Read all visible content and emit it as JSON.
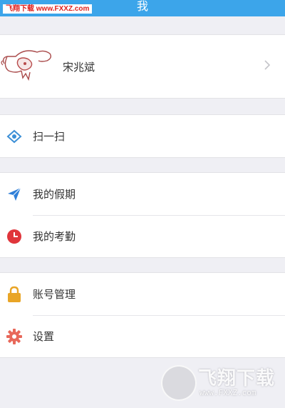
{
  "header": {
    "title": "我"
  },
  "watermark_top": {
    "text": "飞翔下载 www.FXXZ.com"
  },
  "profile": {
    "name": "宋兆斌"
  },
  "menu": {
    "scan": "扫一扫",
    "vacation": "我的假期",
    "attendance": "我的考勤",
    "account": "账号管理",
    "settings": "设置"
  },
  "watermark_bottom": {
    "brand": "飞翔下载",
    "url": "www.FXXZ.com"
  },
  "colors": {
    "header": "#3ca5ea",
    "scan_icon": "#3c8fd6",
    "vacation_icon": "#2f7fd8",
    "attendance_icon": "#e0353b",
    "account_icon": "#e9a526",
    "settings_icon": "#e8685a"
  },
  "icons": {
    "scan": "scan-eye-icon",
    "vacation": "paper-plane-icon",
    "attendance": "clock-icon",
    "account": "lock-icon",
    "settings": "gear-icon",
    "profile_arrow": "chevron-right-icon"
  }
}
